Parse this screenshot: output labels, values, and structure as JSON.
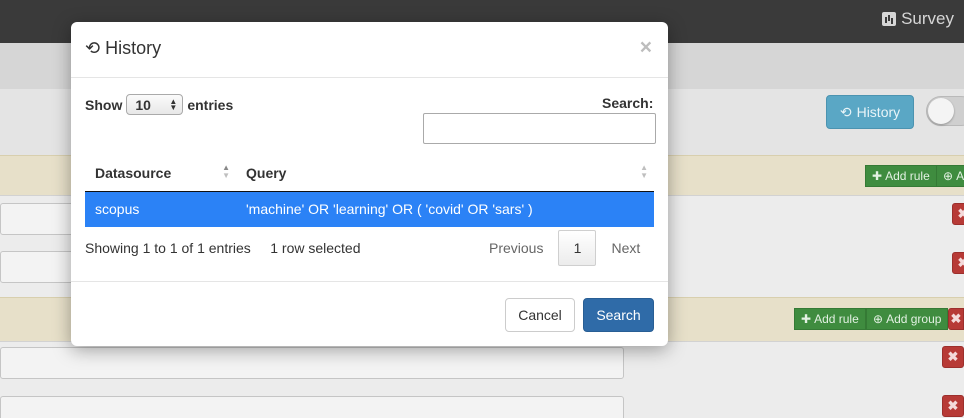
{
  "topbar": {
    "brand_label": "Survey",
    "brand_icon": "bar-chart-icon"
  },
  "background": {
    "history_button_label": "History",
    "add_rule_label": "Add rule",
    "add_group_label": "Add group",
    "add_truncated_label": "A",
    "delete_symbol": "✖",
    "plus_symbol": "✚",
    "plus_circle_symbol": "⊕"
  },
  "modal": {
    "title": "History",
    "title_icon": "history-icon",
    "close_symbol": "×",
    "show_label": "Show",
    "entries_label": "entries",
    "page_length": "10",
    "search_label": "Search:",
    "search_value": "",
    "table": {
      "headers": [
        "Datasource",
        "Query"
      ],
      "rows": [
        {
          "datasource": "scopus",
          "query": "'machine' OR 'learning' OR ( 'covid' OR 'sars' )",
          "selected": true
        }
      ]
    },
    "info_text": "Showing 1 to 1 of 1 entries",
    "selection_text": "1 row selected",
    "pager": {
      "previous": "Previous",
      "current": "1",
      "next": "Next"
    },
    "footer": {
      "cancel_label": "Cancel",
      "search_label": "Search"
    }
  },
  "colors": {
    "selected_row": "#2b82f6",
    "primary_button": "#2f6ba8",
    "info_button": "#5aa7c5",
    "success": "#3f8c3f",
    "danger": "#b73a36"
  }
}
